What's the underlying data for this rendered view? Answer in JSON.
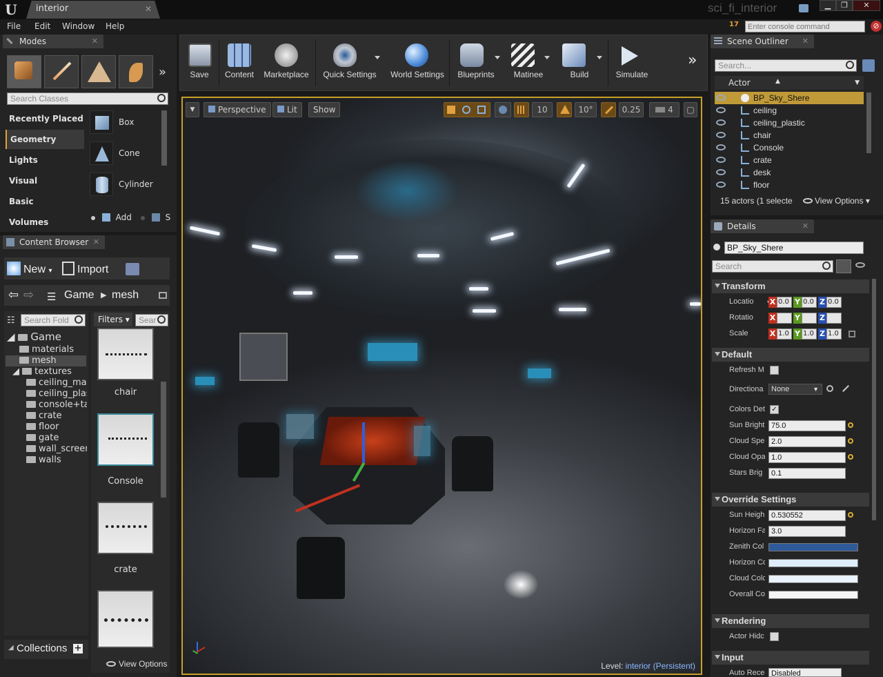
{
  "window": {
    "doc_tab": "interior",
    "project_name": "sci_fi_interior",
    "minimize": "▁",
    "maximize": "❐",
    "close": "✕"
  },
  "menu": [
    "File",
    "Edit",
    "Window",
    "Help"
  ],
  "console": {
    "warning_count": "17",
    "placeholder": "Enter console command"
  },
  "modes": {
    "tab_label": "Modes",
    "search_placeholder": "Search Classes",
    "categories": [
      "Recently Placed",
      "Geometry",
      "Lights",
      "Visual",
      "Basic",
      "Volumes"
    ],
    "active_category": "Geometry",
    "items": [
      "Box",
      "Cone",
      "Cylinder"
    ],
    "footer_add": "Add",
    "footer_sub": "S"
  },
  "content_browser": {
    "tab_label": "Content Browser",
    "new_label": "New",
    "import_label": "Import",
    "path": [
      "Game",
      "mesh"
    ],
    "folder_search_placeholder": "Search Fold",
    "filters_label": "Filters",
    "asset_search_placeholder": "Sear",
    "tree": {
      "root": "Game",
      "items": [
        "materials",
        "mesh",
        "textures",
        "ceiling_mai",
        "ceiling_plas",
        "console+tal",
        "crate",
        "floor",
        "gate",
        "wall_screer",
        "walls"
      ]
    },
    "assets": [
      "chair",
      "Console",
      "crate"
    ],
    "collections_label": "Collections",
    "view_options_label": "View Options"
  },
  "toolbar": {
    "items": [
      "Save",
      "Content",
      "Marketplace",
      "Quick Settings",
      "World Settings",
      "Blueprints",
      "Matinee",
      "Build",
      "Simulate"
    ]
  },
  "viewport": {
    "perspective_label": "Perspective",
    "lit_label": "Lit",
    "show_label": "Show",
    "grid_snap": "10",
    "rotation_snap": "10°",
    "scale_snap": "0.25",
    "camera_speed": "4",
    "level_prefix": "Level:",
    "level_name": "interior (Persistent)"
  },
  "outliner": {
    "tab_label": "Scene Outliner",
    "search_placeholder": "Search...",
    "column_header": "Actor",
    "actors": [
      "BP_Sky_Shere",
      "ceiling",
      "ceiling_plastic",
      "chair",
      "Console",
      "crate",
      "desk",
      "floor"
    ],
    "selected_actor": "BP_Sky_Shere",
    "status": "15 actors (1 selecte",
    "view_options_label": "View Options"
  },
  "details": {
    "tab_label": "Details",
    "object_name": "BP_Sky_Shere",
    "search_placeholder": "Search",
    "transform": {
      "title": "Transform",
      "location_label": "Locatio",
      "rotation_label": "Rotatio",
      "scale_label": "Scale",
      "location": [
        "0.0",
        "0.0",
        "0.0"
      ],
      "rotation": [
        "",
        "",
        ""
      ],
      "scale": [
        "1.0",
        "1.0",
        "1.0"
      ]
    },
    "default": {
      "title": "Default",
      "refresh_label": "Refresh M",
      "directional_label": "Directiona",
      "directional_value": "None",
      "colors_label": "Colors Det",
      "sun_brightness_label": "Sun Bright",
      "sun_brightness": "75.0",
      "cloud_speed_label": "Cloud Spe",
      "cloud_speed": "2.0",
      "cloud_opacity_label": "Cloud Opa",
      "cloud_opacity": "1.0",
      "stars_label": "Stars Brig",
      "stars": "0.1"
    },
    "override": {
      "title": "Override Settings",
      "sun_height_label": "Sun Heigh",
      "sun_height": "0.530552",
      "horizon_falloff_label": "Horizon Fa",
      "horizon_falloff": "3.0",
      "zenith_label": "Zenith Col",
      "horizon_color_label": "Horizon Co",
      "cloud_color_label": "Cloud Colc",
      "overall_label": "Overall Co"
    },
    "rendering": {
      "title": "Rendering",
      "actor_hidden_label": "Actor Hidc"
    },
    "input": {
      "title": "Input",
      "auto_receive_label": "Auto Rece",
      "auto_receive_value": "Disabled"
    }
  },
  "colors": {
    "accent": "#c09a38",
    "zenith": "#2f5a9a",
    "horizon": "#dfeefa",
    "cloud": "#eaf2fb",
    "overall": "#f6f6f6",
    "x_axis": "#c03020",
    "y_axis": "#5a9a20",
    "z_axis": "#2850b0"
  }
}
